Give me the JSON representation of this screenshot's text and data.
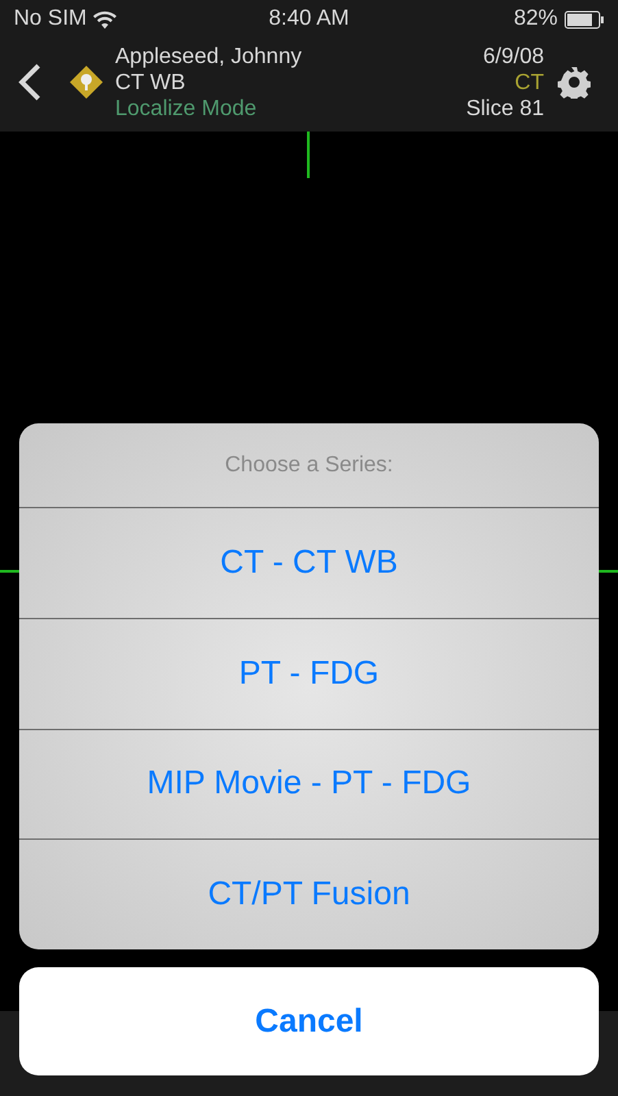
{
  "status_bar": {
    "carrier": "No SIM",
    "time": "8:40 AM",
    "battery": "82%"
  },
  "header": {
    "patient": "Appleseed, Johnny",
    "series": "CT WB",
    "mode": "Localize Mode",
    "date": "6/9/08",
    "modality": "CT",
    "slice": "Slice 81"
  },
  "action_sheet": {
    "title": "Choose a Series:",
    "options": [
      "CT - CT WB",
      "PT - FDG",
      "MIP Movie - PT - FDG",
      "CT/PT Fusion"
    ],
    "cancel": "Cancel"
  }
}
